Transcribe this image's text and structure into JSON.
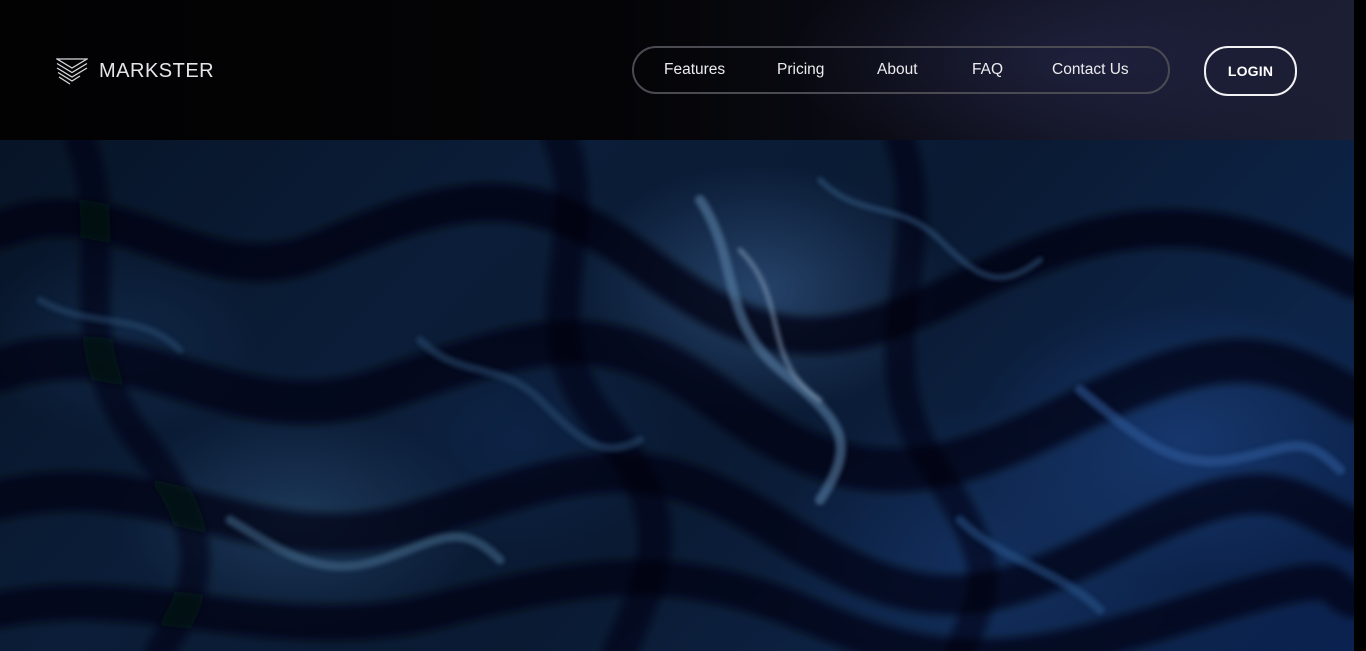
{
  "brand": {
    "name": "MARKSTER",
    "icon": "layered-chevron-logo-icon"
  },
  "nav": {
    "items": [
      {
        "label": "Features"
      },
      {
        "label": "Pricing"
      },
      {
        "label": "About"
      },
      {
        "label": "FAQ"
      },
      {
        "label": "Contact Us"
      }
    ]
  },
  "login": {
    "label": "LOGIN"
  },
  "colors": {
    "header_bg": "#040406",
    "hero_base": "#0b1d38",
    "nav_border": "#4a4b52",
    "text": "#ececef",
    "login_border": "#f2f2f4"
  }
}
